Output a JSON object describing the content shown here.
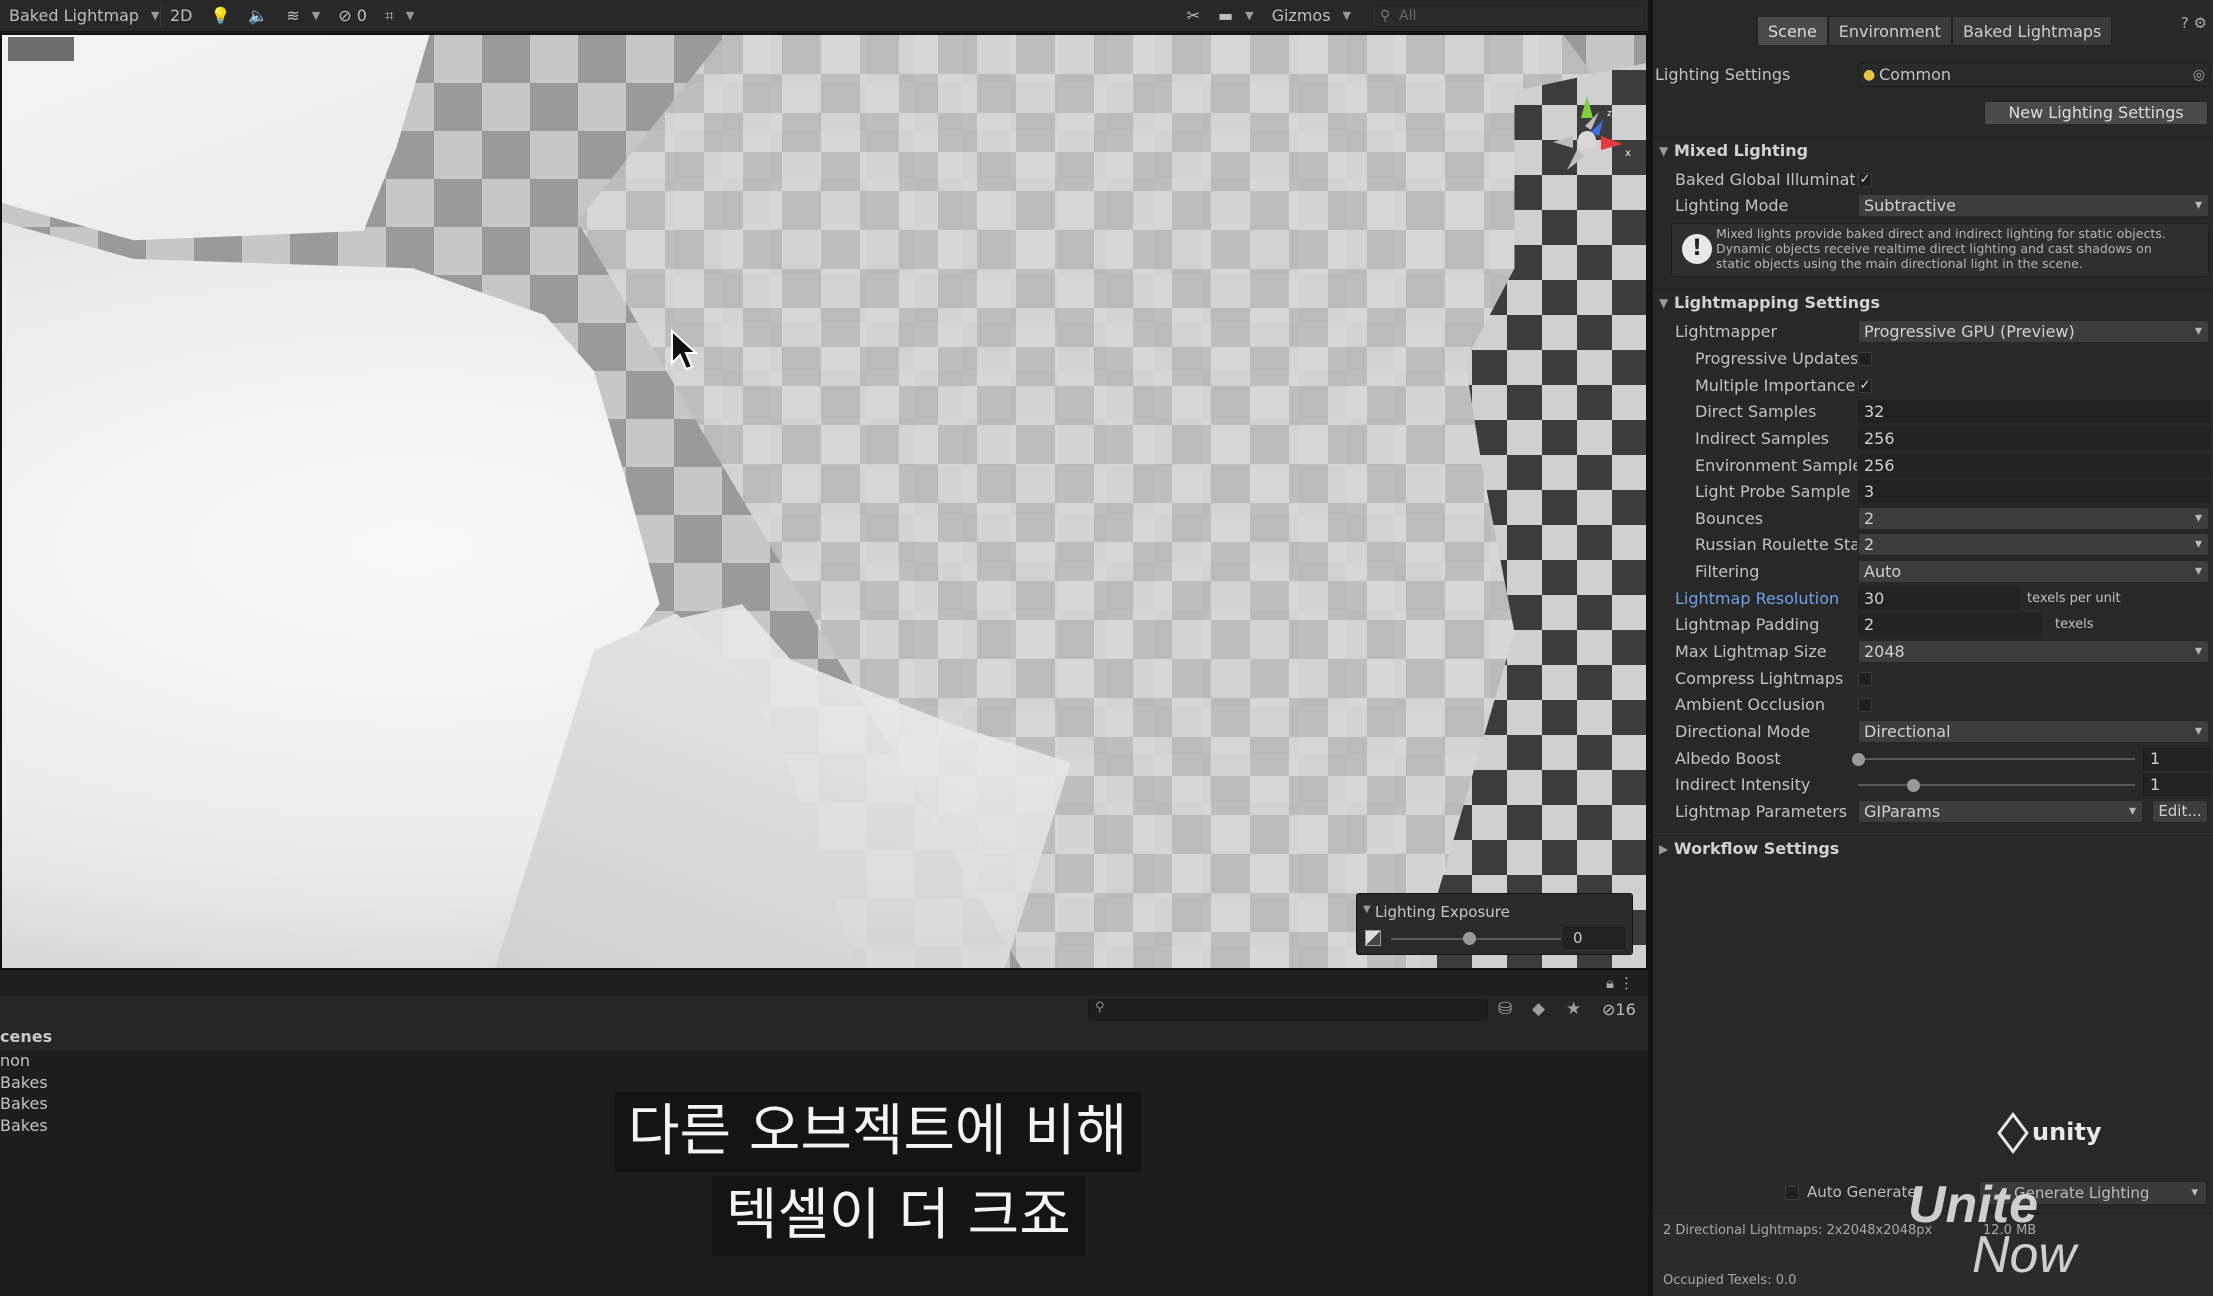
{
  "scene_toolbar": {
    "view_mode": "Baked Lightmap",
    "mode_2d": "2D",
    "hidden_objects": "0",
    "gizmos": "Gizmos",
    "search_placeholder": "All"
  },
  "exposure": {
    "title": "Lighting Exposure",
    "value": "0"
  },
  "hierarchy": {
    "hidden_count": "16",
    "header": "cenes",
    "rows": [
      "non",
      "Bakes",
      "Bakes",
      "Bakes"
    ]
  },
  "subtitle": {
    "line1": "다른 오브젝트에 비해",
    "line2": "텍셀이 더 크죠"
  },
  "lighting": {
    "tabs": [
      "Scene",
      "Environment",
      "Baked Lightmaps"
    ],
    "lighting_settings_label": "Lighting Settings",
    "lighting_settings_value": "Common",
    "new_lighting_settings": "New Lighting Settings",
    "mixed_lighting": {
      "title": "Mixed Lighting",
      "baked_gi_label": "Baked Global Illuminatio",
      "baked_gi_checked": true,
      "lighting_mode_label": "Lighting Mode",
      "lighting_mode_value": "Subtractive",
      "info_line1": "Mixed lights provide baked direct and indirect lighting for static objects.",
      "info_line2": "Dynamic objects receive realtime direct lighting and cast shadows on",
      "info_line3": "static objects using the main directional light in the scene."
    },
    "lightmapping": {
      "title": "Lightmapping Settings",
      "lightmapper_label": "Lightmapper",
      "lightmapper_value": "Progressive GPU (Preview)",
      "progressive_updates_label": "Progressive Updates",
      "progressive_updates_checked": false,
      "multiple_importance_label": "Multiple Importance S",
      "multiple_importance_checked": true,
      "direct_samples_label": "Direct Samples",
      "direct_samples_value": "32",
      "indirect_samples_label": "Indirect Samples",
      "indirect_samples_value": "256",
      "environment_samples_label": "Environment Samples",
      "environment_samples_value": "256",
      "light_probe_label": "Light Probe Sample M",
      "light_probe_value": "3",
      "bounces_label": "Bounces",
      "bounces_value": "2",
      "russian_roulette_label": "Russian Roulette Star",
      "russian_roulette_value": "2",
      "filtering_label": "Filtering",
      "filtering_value": "Auto",
      "lightmap_resolution_label": "Lightmap Resolution",
      "lightmap_resolution_value": "30",
      "lightmap_resolution_unit": "texels per unit",
      "lightmap_padding_label": "Lightmap Padding",
      "lightmap_padding_value": "2",
      "lightmap_padding_unit": "texels",
      "max_lightmap_size_label": "Max Lightmap Size",
      "max_lightmap_size_value": "2048",
      "compress_label": "Compress Lightmaps",
      "compress_checked": false,
      "ambient_occlusion_label": "Ambient Occlusion",
      "ambient_occlusion_checked": false,
      "directional_mode_label": "Directional Mode",
      "directional_mode_value": "Directional",
      "albedo_boost_label": "Albedo Boost",
      "albedo_boost_value": "1",
      "albedo_boost_fraction": 0.0,
      "indirect_intensity_label": "Indirect Intensity",
      "indirect_intensity_value": "1",
      "indirect_intensity_fraction": 0.2,
      "lightmap_parameters_label": "Lightmap Parameters",
      "lightmap_parameters_value": "GIParams",
      "edit_button": "Edit..."
    },
    "workflow": {
      "title": "Workflow Settings"
    },
    "auto_generate": "Auto Generate",
    "generate_lighting": "Generate Lighting",
    "stats_lightmaps": "2 Directional Lightmaps: 2x2048x2048px",
    "stats_size": "12.0 MB",
    "stats_occupied": "Occupied Texels: 0.0"
  },
  "branding": {
    "unity": "unity",
    "unite_line1": "Unite",
    "unite_line2": "Now"
  }
}
